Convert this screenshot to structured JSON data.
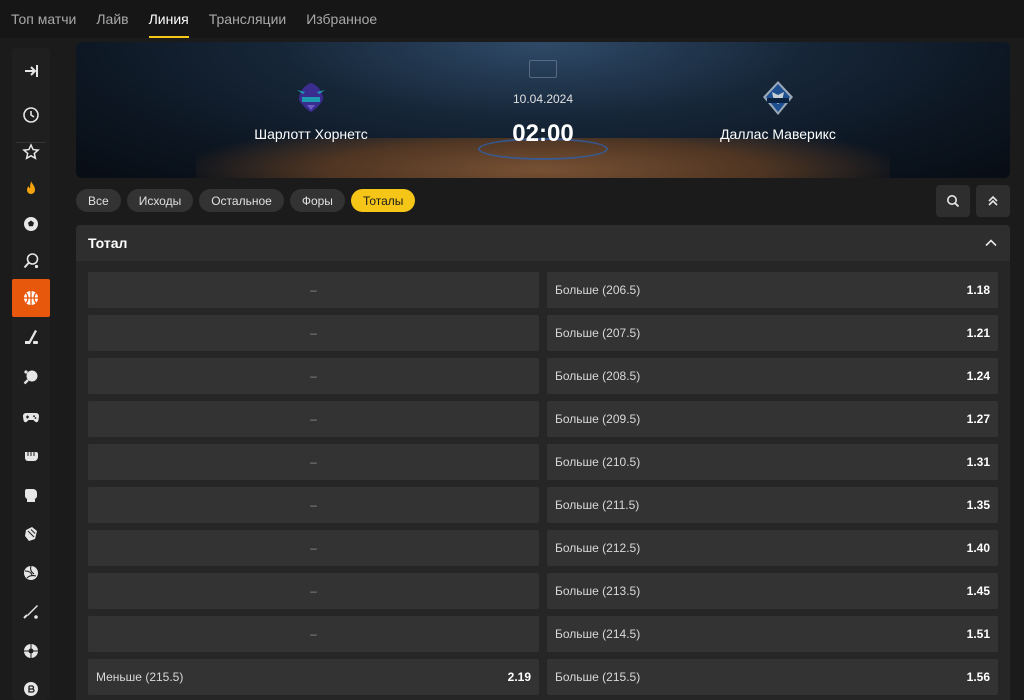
{
  "topnav": {
    "tabs": [
      {
        "label": "Топ матчи",
        "active": false
      },
      {
        "label": "Лайв",
        "active": false
      },
      {
        "label": "Линия",
        "active": true
      },
      {
        "label": "Трансляции",
        "active": false
      },
      {
        "label": "Избранное",
        "active": false
      }
    ]
  },
  "sidebar": {
    "items": [
      {
        "icon": "collapse-icon",
        "active": false
      },
      {
        "icon": "clock-icon",
        "active": false
      },
      {
        "icon": "star-icon",
        "active": false
      },
      {
        "icon": "fire-icon",
        "active": false
      },
      {
        "icon": "soccer-icon",
        "active": false
      },
      {
        "icon": "tennis-icon",
        "active": false
      },
      {
        "icon": "basketball-icon",
        "active": true
      },
      {
        "icon": "hockey-icon",
        "active": false
      },
      {
        "icon": "table-tennis-icon",
        "active": false
      },
      {
        "icon": "gamepad-icon",
        "active": false
      },
      {
        "icon": "fist-icon",
        "active": false
      },
      {
        "icon": "boxing-glove-icon",
        "active": false
      },
      {
        "icon": "mma-glove-icon",
        "active": false
      },
      {
        "icon": "volleyball-icon",
        "active": false
      },
      {
        "icon": "baseball-icon",
        "active": false
      },
      {
        "icon": "handball-icon",
        "active": false
      },
      {
        "icon": "coin-icon",
        "active": false
      }
    ],
    "accent": "#e8580c"
  },
  "event": {
    "home_team": "Шарлотт Хорнетс",
    "away_team": "Даллас Маверикс",
    "date": "10.04.2024",
    "time": "02:00"
  },
  "filters": {
    "chips": [
      {
        "label": "Все",
        "active": false
      },
      {
        "label": "Исходы",
        "active": false
      },
      {
        "label": "Остальное",
        "active": false
      },
      {
        "label": "Форы",
        "active": false
      },
      {
        "label": "Тоталы",
        "active": true
      }
    ],
    "accent": "#f5c518"
  },
  "market": {
    "title": "Тотал",
    "empty_placeholder": "–",
    "rows": [
      {
        "under_label": "",
        "under_odd": "",
        "over_label": "Больше (206.5)",
        "over_odd": "1.18"
      },
      {
        "under_label": "",
        "under_odd": "",
        "over_label": "Больше (207.5)",
        "over_odd": "1.21"
      },
      {
        "under_label": "",
        "under_odd": "",
        "over_label": "Больше (208.5)",
        "over_odd": "1.24"
      },
      {
        "under_label": "",
        "under_odd": "",
        "over_label": "Больше (209.5)",
        "over_odd": "1.27"
      },
      {
        "under_label": "",
        "under_odd": "",
        "over_label": "Больше (210.5)",
        "over_odd": "1.31"
      },
      {
        "under_label": "",
        "under_odd": "",
        "over_label": "Больше (211.5)",
        "over_odd": "1.35"
      },
      {
        "under_label": "",
        "under_odd": "",
        "over_label": "Больше (212.5)",
        "over_odd": "1.40"
      },
      {
        "under_label": "",
        "under_odd": "",
        "over_label": "Больше (213.5)",
        "over_odd": "1.45"
      },
      {
        "under_label": "",
        "under_odd": "",
        "over_label": "Больше (214.5)",
        "over_odd": "1.51"
      },
      {
        "under_label": "Меньше (215.5)",
        "under_odd": "2.19",
        "over_label": "Больше (215.5)",
        "over_odd": "1.56"
      }
    ]
  }
}
